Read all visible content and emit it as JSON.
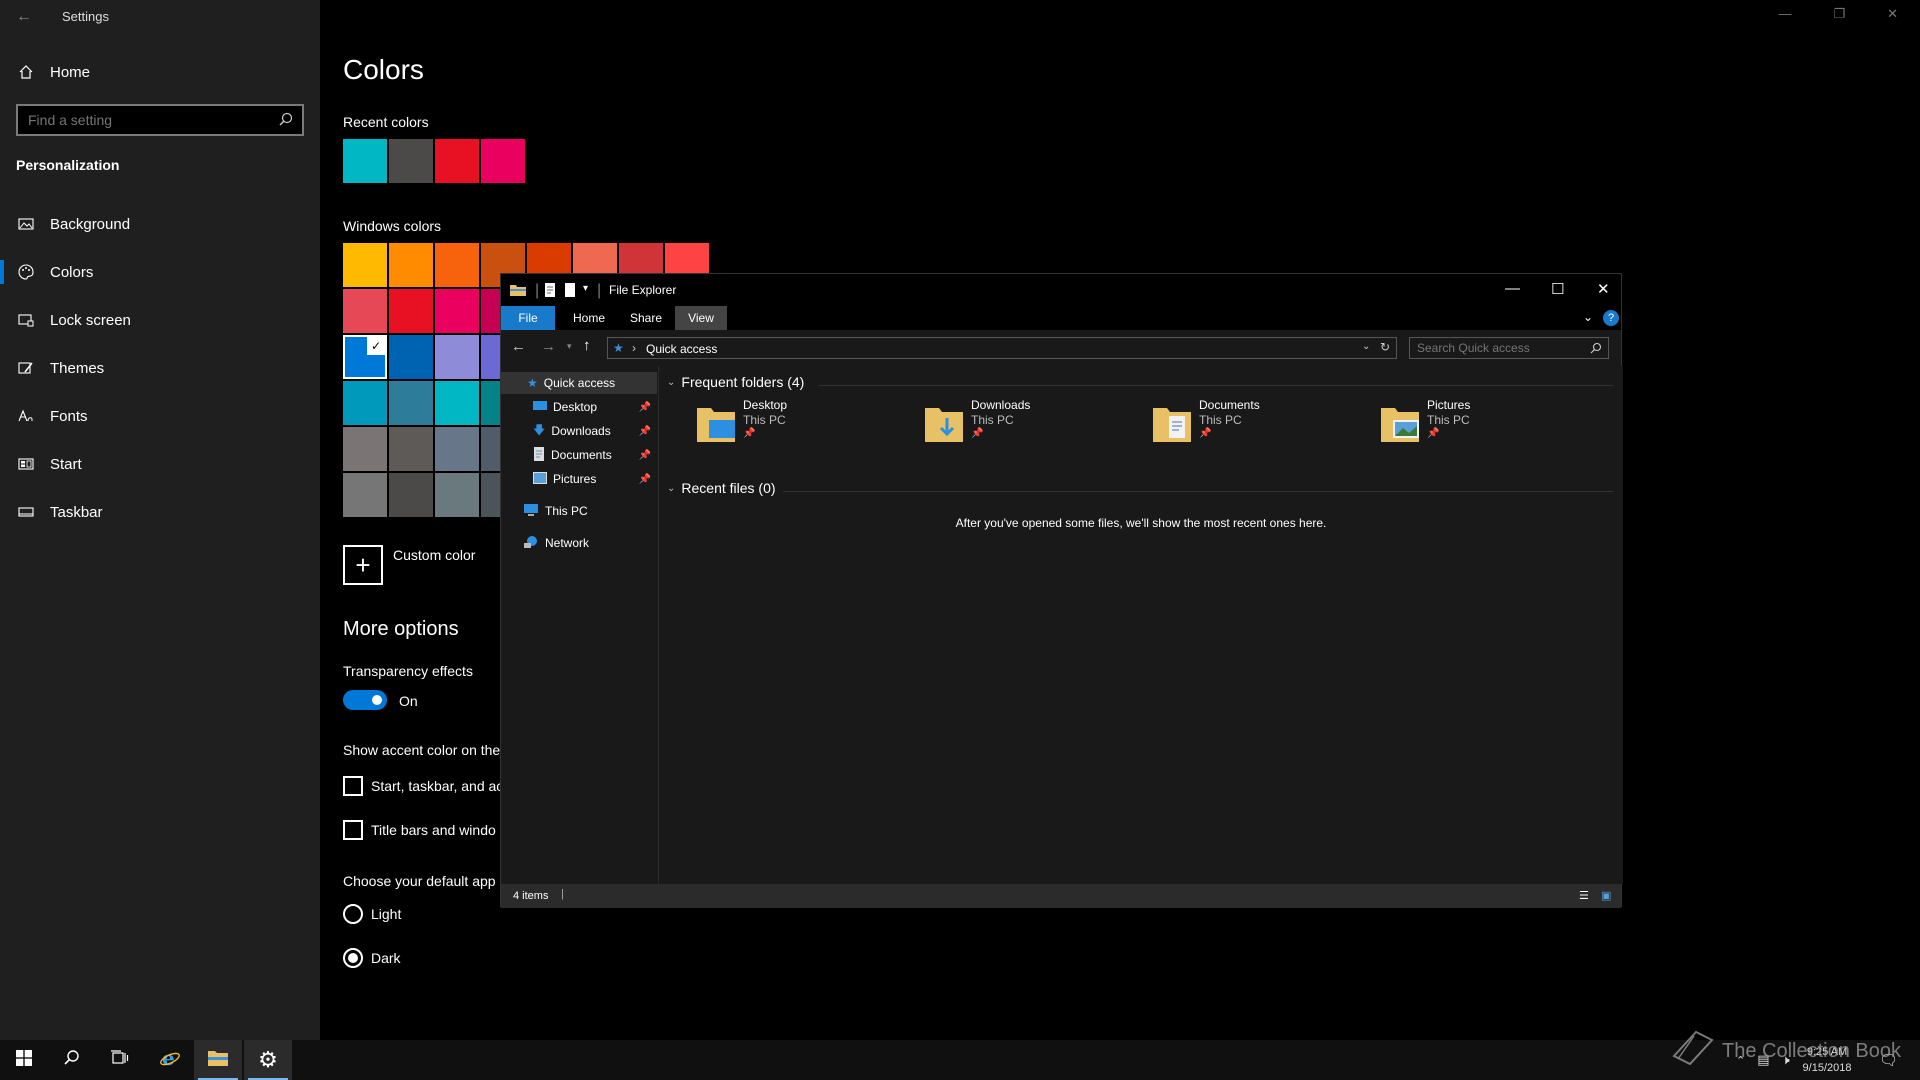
{
  "settings": {
    "window_title": "Settings",
    "search_placeholder": "Find a setting",
    "home_label": "Home",
    "section_label": "Personalization",
    "nav": [
      {
        "label": "Background",
        "icon": "image-icon"
      },
      {
        "label": "Colors",
        "icon": "palette-icon",
        "active": true
      },
      {
        "label": "Lock screen",
        "icon": "lock-screen-icon"
      },
      {
        "label": "Themes",
        "icon": "themes-icon"
      },
      {
        "label": "Fonts",
        "icon": "fonts-icon"
      },
      {
        "label": "Start",
        "icon": "start-icon"
      },
      {
        "label": "Taskbar",
        "icon": "taskbar-icon"
      }
    ]
  },
  "colors_page": {
    "title": "Colors",
    "recent_label": "Recent colors",
    "recent_colors": [
      "#00b7c3",
      "#4c4a48",
      "#e81123",
      "#ea005e"
    ],
    "windows_label": "Windows colors",
    "windows_colors": [
      [
        "#ffb900",
        "#ff8c00",
        "#f7630c",
        "#ca5010",
        "#da3b01",
        "#ef6950",
        "#d13438",
        "#ff4343"
      ],
      [
        "#e74856",
        "#e81123",
        "#ea005e",
        "#c30052"
      ],
      [
        "#0078d7",
        "#0063b1",
        "#8e8cd8",
        "#6b69d6"
      ],
      [
        "#0099bc",
        "#2d7d9a",
        "#00b7c3",
        "#038387"
      ],
      [
        "#7a7574",
        "#5d5a58",
        "#68768a",
        "#515c6b"
      ],
      [
        "#767676",
        "#4c4a48",
        "#69797e",
        "#4a5459"
      ]
    ],
    "custom_color_label": "Custom color",
    "more_options_label": "More options",
    "transparency_label": "Transparency effects",
    "transparency_value": "On",
    "accent_surfaces_label": "Show accent color on the",
    "checkbox_start_label": "Start, taskbar, and ac",
    "checkbox_titlebar_label": "Title bars and windo",
    "app_mode_label": "Choose your default app",
    "mode_light": "Light",
    "mode_dark": "Dark"
  },
  "explorer": {
    "title": "File Explorer",
    "tabs": {
      "file": "File",
      "home": "Home",
      "share": "Share",
      "view": "View"
    },
    "address": "Quick access",
    "search_placeholder": "Search Quick access",
    "tree": {
      "quick_access": "Quick access",
      "desktop": "Desktop",
      "downloads": "Downloads",
      "documents": "Documents",
      "pictures": "Pictures",
      "this_pc": "This PC",
      "network": "Network"
    },
    "frequent_header": "Frequent folders (4)",
    "folders": [
      {
        "name": "Desktop",
        "location": "This PC"
      },
      {
        "name": "Downloads",
        "location": "This PC"
      },
      {
        "name": "Documents",
        "location": "This PC"
      },
      {
        "name": "Pictures",
        "location": "This PC"
      }
    ],
    "recent_header": "Recent files (0)",
    "recent_empty": "After you've opened some files, we'll show the most recent ones here.",
    "status": "4 items"
  },
  "taskbar": {
    "clock_time": "9:25 AM",
    "clock_date": "9/15/2018",
    "watermark": "The Collection Book"
  },
  "colors": {
    "accent": "#0078d7",
    "folder": "#e8c065"
  }
}
